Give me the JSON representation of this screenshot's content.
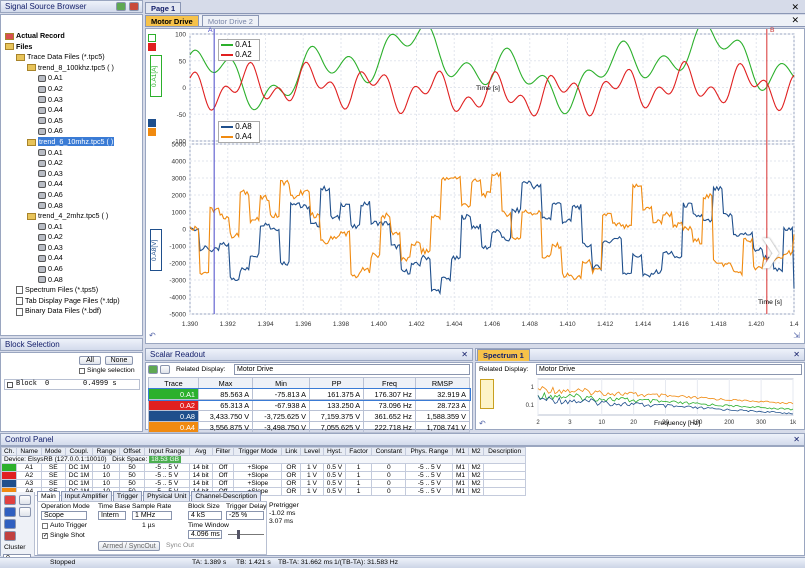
{
  "browser": {
    "title": "Signal Source Browser"
  },
  "tree": [
    {
      "label": "Actual Record",
      "level": 0,
      "icon": "record",
      "bold": true
    },
    {
      "label": "Files",
      "level": 0,
      "icon": "folder",
      "bold": true
    },
    {
      "label": "Trace Data Files (*.tpc5)",
      "level": 1,
      "icon": "folder"
    },
    {
      "label": "trend_8_100khz.tpc5 ( )",
      "level": 2,
      "icon": "folder"
    },
    {
      "label": "0.A1",
      "level": 3,
      "icon": "chan"
    },
    {
      "label": "0.A2",
      "level": 3,
      "icon": "chan"
    },
    {
      "label": "0.A3",
      "level": 3,
      "icon": "chan"
    },
    {
      "label": "0.A4",
      "level": 3,
      "icon": "chan"
    },
    {
      "label": "0.A5",
      "level": 3,
      "icon": "chan"
    },
    {
      "label": "0.A6",
      "level": 3,
      "icon": "chan"
    },
    {
      "label": "trend_6_10mhz.tpc5 ( )",
      "level": 2,
      "icon": "folder",
      "selected": true
    },
    {
      "label": "0.A1",
      "level": 3,
      "icon": "chan"
    },
    {
      "label": "0.A2",
      "level": 3,
      "icon": "chan"
    },
    {
      "label": "0.A3",
      "level": 3,
      "icon": "chan"
    },
    {
      "label": "0.A4",
      "level": 3,
      "icon": "chan"
    },
    {
      "label": "0.A6",
      "level": 3,
      "icon": "chan"
    },
    {
      "label": "0.A8",
      "level": 3,
      "icon": "chan"
    },
    {
      "label": "trend_4_2mhz.tpc5 ( )",
      "level": 2,
      "icon": "folder"
    },
    {
      "label": "0.A1",
      "level": 3,
      "icon": "chan"
    },
    {
      "label": "0.A2",
      "level": 3,
      "icon": "chan"
    },
    {
      "label": "0.A3",
      "level": 3,
      "icon": "chan"
    },
    {
      "label": "0.A4",
      "level": 3,
      "icon": "chan"
    },
    {
      "label": "0.A6",
      "level": 3,
      "icon": "chan"
    },
    {
      "label": "0.A8",
      "level": 3,
      "icon": "chan"
    },
    {
      "label": "Spectrum Files (*.tps5)",
      "level": 1,
      "icon": "file"
    },
    {
      "label": "Tab Display Page Files (*.tdp)",
      "level": 1,
      "icon": "file"
    },
    {
      "label": "Binary Data Files (*.bdf)",
      "level": 1,
      "icon": "file"
    }
  ],
  "block_selection": {
    "title": "Block Selection",
    "all": "All",
    "none": "None",
    "single": "Single selection",
    "row": {
      "name": "Block",
      "num": "0",
      "value": "0.4999 s"
    }
  },
  "page": {
    "tab": "Page 1",
    "display_tabs": [
      "Motor Drive",
      "Motor Drive 2"
    ]
  },
  "cursors": {
    "a": "A",
    "b": "B"
  },
  "plot_top": {
    "axis_label": "0.A1[A]",
    "legend": [
      "0.A1",
      "0.A2"
    ],
    "yticks": [
      "100",
      "50",
      "0",
      "-50",
      "-100"
    ],
    "ylim": [
      -100,
      100
    ],
    "unit": "Time [s]"
  },
  "plot_bot": {
    "axis_label": "0.A8[V]",
    "legend": [
      "0.A8",
      "0.A4"
    ],
    "yticks": [
      "5000",
      "4000",
      "3000",
      "2000",
      "1000",
      "0",
      "-1000",
      "-2000",
      "-3000",
      "-4000",
      "-5000"
    ],
    "ylim": [
      -5000,
      5000
    ]
  },
  "xticks": [
    "1.390",
    "1.392",
    "1.394",
    "1.396",
    "1.398",
    "1.400",
    "1.402",
    "1.404",
    "1.406",
    "1.408",
    "1.410",
    "1.412",
    "1.414",
    "1.416",
    "1.418",
    "1.420",
    "1.4"
  ],
  "xlabel": "Time [s]",
  "scalar": {
    "title": "Scalar Readout",
    "related_label": "Related Display:",
    "related_value": "Motor Drive",
    "headers": [
      "Trace",
      "Max",
      "Min",
      "PP",
      "Freq",
      "RMSP"
    ],
    "rows": [
      {
        "trace": "0.A1",
        "max": "85.563 A",
        "min": "-75.813 A",
        "pp": "161.375 A",
        "freq": "176.307 Hz",
        "rmsp": "32.919 A",
        "color": "#2cb02c"
      },
      {
        "trace": "0.A2",
        "max": "65.313 A",
        "min": "-67.938 A",
        "pp": "133.250 A",
        "freq": "73.096 Hz",
        "rmsp": "28.723 A",
        "color": "#e02020"
      },
      {
        "trace": "0.A8",
        "max": "3,433.750 V",
        "min": "-3,725.625 V",
        "pp": "7,159.375 V",
        "freq": "361.652 Hz",
        "rmsp": "1,588.359 V",
        "color": "#1f4f8c"
      },
      {
        "trace": "0.A4",
        "max": "3,556.875 V",
        "min": "-3,498.750 V",
        "pp": "7,055.625 V",
        "freq": "222.718 Hz",
        "rmsp": "1,708.741 V",
        "color": "#f08a10"
      }
    ]
  },
  "spectrum": {
    "title": "Spectrum 1",
    "related_label": "Related Display:",
    "related_value": "Motor Drive",
    "xlabel": "Frequency [Hz]",
    "xticks": [
      "2",
      "3",
      "10",
      "20",
      "30",
      "100",
      "200",
      "300",
      "1k"
    ],
    "yticks": [
      "1",
      "0.1"
    ]
  },
  "control": {
    "title": "Control Panel",
    "headers": [
      "Ch.",
      "Name",
      "Mode",
      "Coupl.",
      "Range",
      "Offset",
      "Input Range",
      "Avg",
      "Filter",
      "Trigger Mode",
      "Link",
      "Level",
      "Hyst.",
      "Factor",
      "Constant",
      "Phys. Range",
      "M1",
      "M2",
      "Description"
    ],
    "device": "Device: ElsysRB (127.0.0.1:10010)",
    "disk_label": "Disk Space:",
    "disk_value": "18.53 GB",
    "rows": [
      {
        "ch": "A1",
        "mode": "SE",
        "coupl": "DC 1M",
        "range": "10",
        "offset": "50",
        "irange": "-5 .. 5 V",
        "avg": "14 bit",
        "filter": "Off",
        "tmode": "+Slope",
        "link": "OR",
        "level": "1 V",
        "hyst": "0.5 V",
        "factor": "1",
        "const": "0",
        "prange": "-5 .. 5 V",
        "m1": "M1",
        "m2": "M2",
        "color": "#2cb02c"
      },
      {
        "ch": "A2",
        "mode": "SE",
        "coupl": "DC 1M",
        "range": "10",
        "offset": "50",
        "irange": "-5 .. 5 V",
        "avg": "14 bit",
        "filter": "Off",
        "tmode": "+Slope",
        "link": "OR",
        "level": "1 V",
        "hyst": "0.5 V",
        "factor": "1",
        "const": "0",
        "prange": "-5 .. 5 V",
        "m1": "M1",
        "m2": "M2",
        "color": "#e02020"
      },
      {
        "ch": "A3",
        "mode": "SE",
        "coupl": "DC 1M",
        "range": "10",
        "offset": "50",
        "irange": "-5 .. 5 V",
        "avg": "14 bit",
        "filter": "Off",
        "tmode": "+Slope",
        "link": "OR",
        "level": "1 V",
        "hyst": "0.5 V",
        "factor": "1",
        "const": "0",
        "prange": "-5 .. 5 V",
        "m1": "M1",
        "m2": "M2",
        "color": "#1f4f8c"
      },
      {
        "ch": "A4",
        "mode": "SE",
        "coupl": "DC 1M",
        "range": "10",
        "offset": "50",
        "irange": "-5 .. 5 V",
        "avg": "14 bit",
        "filter": "Off",
        "tmode": "+Slope",
        "link": "OR",
        "level": "1 V",
        "hyst": "0.5 V",
        "factor": "1",
        "const": "0",
        "prange": "-5 .. 5 V",
        "m1": "M1",
        "m2": "M2",
        "color": "#f08a10"
      }
    ],
    "sub_tabs": [
      "Main",
      "Input Amplifier",
      "Trigger",
      "Physical Unit",
      "Channel-Description"
    ],
    "op_mode_label": "Operation Mode",
    "op_mode": "Scope",
    "auto_trigger": "Auto Trigger",
    "single_shot": "Single Shot",
    "time_base_label": "Time Base",
    "time_base": "Intern",
    "sample_rate_label": "Sample Rate",
    "sample_rate": "1 MHz",
    "sample_step": "1 µs",
    "block_size_label": "Block Size",
    "block_size": "4 kS",
    "trig_delay_label": "Trigger Delay",
    "trig_delay": "-25 %",
    "pretrigger_label": "Pretrigger",
    "pretrigger": "-1.02 ms",
    "pretrigger2": "3.07 ms",
    "time_window_label": "Time Window",
    "time_window": "4.096 ms",
    "armed": "Armed / SyncOut",
    "sync_out": "Sync Out",
    "cluster_label": "Cluster",
    "cluster": "0"
  },
  "status": {
    "state": "Stopped",
    "ta": "TA: 1.389 s",
    "tb": "TB: 1.421 s",
    "tbta": "TB-TA: 31.662 ms",
    "inv": "1/(TB-TA): 31.583 Hz"
  }
}
